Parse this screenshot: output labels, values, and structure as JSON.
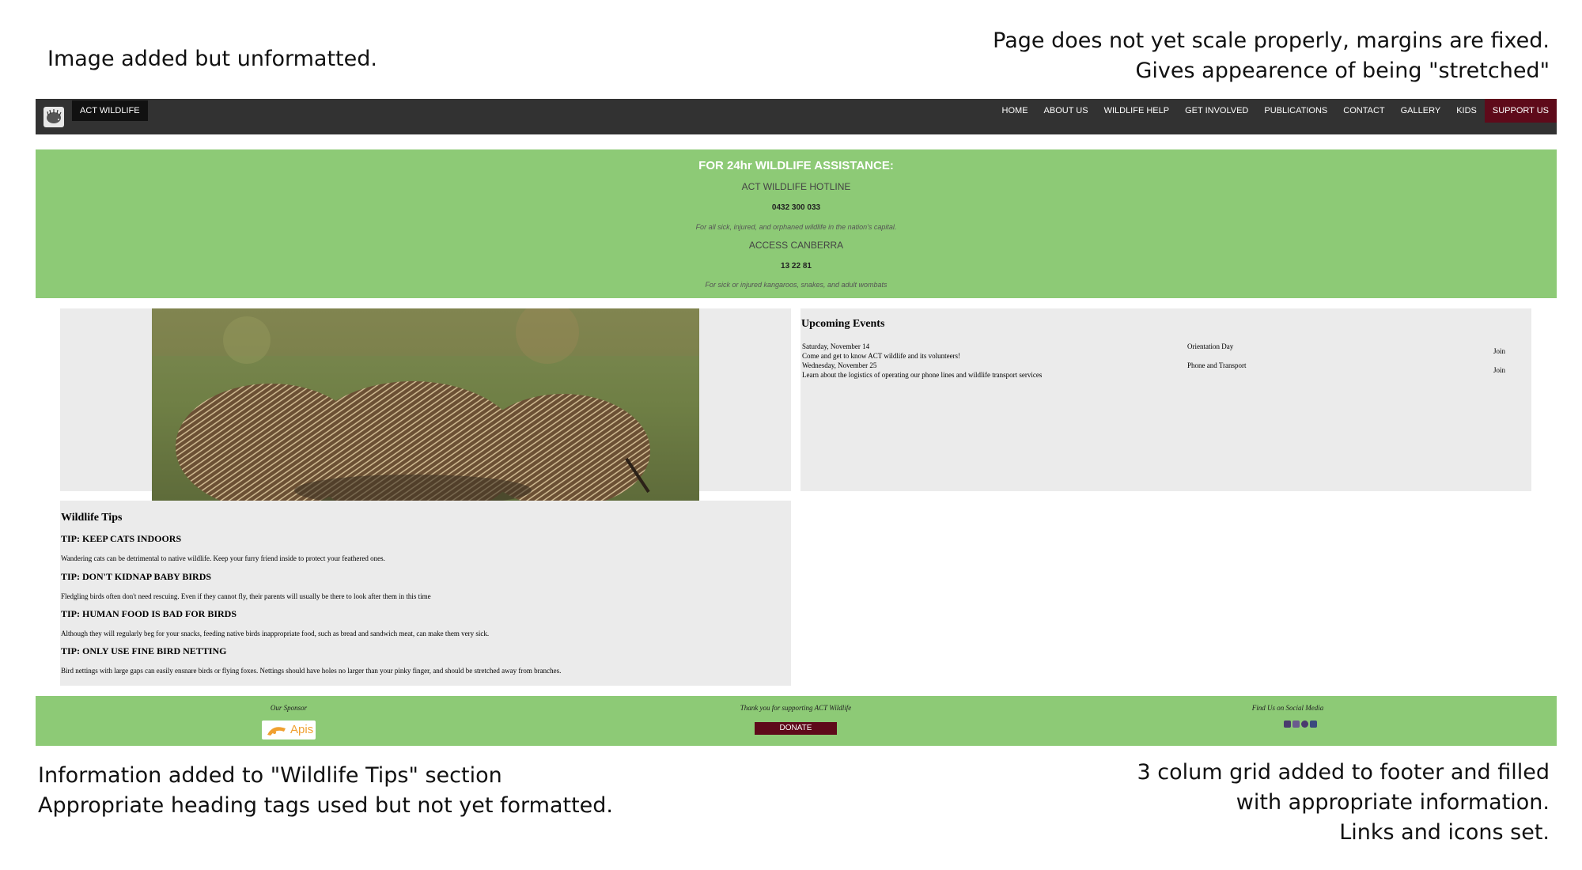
{
  "notes": {
    "top_left": "Image added but unformatted.",
    "top_right_line1": "Page does not yet scale properly, margins are fixed.",
    "top_right_line2": "Gives appearence of being \"stretched\"",
    "bottom_left_line1": "Information added to \"Wildlife Tips\" section",
    "bottom_left_line2": "Appropriate heading tags used but not yet formatted.",
    "bottom_right_line1": "3 colum grid added to footer and filled",
    "bottom_right_line2": "with appropriate information.",
    "bottom_right_line3": "Links and icons set."
  },
  "navbar": {
    "brand": "ACT WILDLIFE",
    "links": [
      "HOME",
      "ABOUT US",
      "WILDLIFE HELP",
      "GET INVOLVED",
      "PUBLICATIONS",
      "CONTACT",
      "GALLERY",
      "KIDS"
    ],
    "support": "SUPPORT US",
    "support_color": "#5e0a1a"
  },
  "banner": {
    "title": "FOR 24hr WILDLIFE ASSISTANCE:",
    "hotline_heading": "ACT WILDLIFE HOTLINE",
    "hotline_number": "0432 300 033",
    "hotline_note": "For all sick, injured, and orphaned wildlife in the nation's capital.",
    "access_heading": "ACCESS CANBERRA",
    "access_number": "13 22 81",
    "access_note": "For sick or injured kangaroos, snakes, and adult wombats",
    "color": "#8dca76"
  },
  "events": {
    "title": "Upcoming Events",
    "items": [
      {
        "date": "Saturday, November 14",
        "name": "Orientation Day",
        "description": "Come and get to know ACT wildlife and its volunteers!",
        "action": "Join"
      },
      {
        "date": "Wednesday, November 25",
        "name": "Phone and Transport",
        "description": "Learn about the logistics of operating our phone lines and wildlife transport services",
        "action": "Join"
      }
    ]
  },
  "tips": {
    "title": "Wildlife Tips",
    "items": [
      {
        "heading": "TIP: KEEP CATS INDOORS",
        "text": "Wandering cats can be detrimental to native wildlife. Keep your furry friend inside to protect your feathered ones."
      },
      {
        "heading": "TIP: DON'T KIDNAP BABY BIRDS",
        "text": "Fledgling birds often don't need rescuing. Even if they cannot fly, their parents will usually be there to look after them in this time"
      },
      {
        "heading": "TIP: HUMAN FOOD IS BAD FOR BIRDS",
        "text": "Although they will regularly beg for your snacks, feeding native birds inappropriate food, such as bread and sandwich meat, can make them very sick."
      },
      {
        "heading": "TIP: ONLY USE FINE BIRD NETTING",
        "text": "Bird nettings with large gaps can easily ensnare birds or flying foxes. Nettings should have holes no larger than your pinky finger, and should be stretched away from branches."
      }
    ]
  },
  "footer": {
    "sponsor_caption": "Our Sponsor",
    "sponsor_name": "Apis",
    "thanks_caption": "Thank you for supporting ACT Wildlife",
    "donate_label": "DONATE",
    "social_caption": "Find Us on Social Media",
    "social_icons": [
      "facebook-icon",
      "instagram-icon",
      "youtube-icon",
      "twitter-icon"
    ]
  }
}
